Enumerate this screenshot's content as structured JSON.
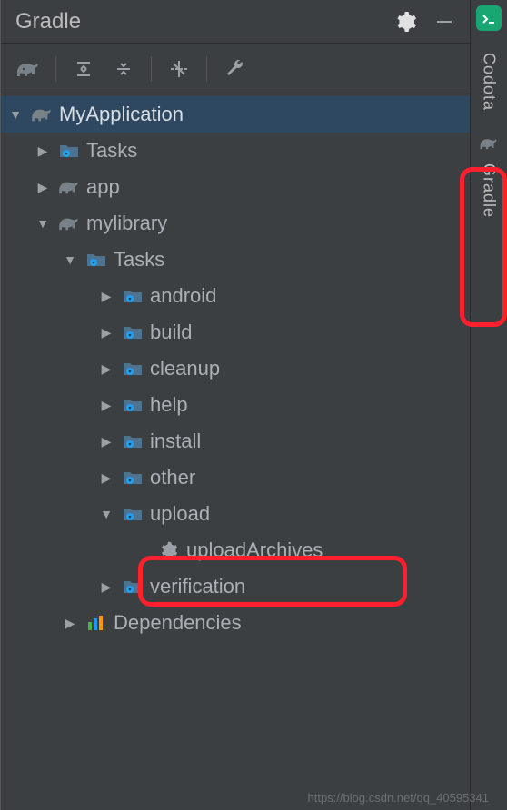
{
  "panel": {
    "title": "Gradle"
  },
  "sidebar": {
    "codota": "Codota",
    "gradle": "Gradle"
  },
  "tree": {
    "root": "MyApplication",
    "tasks": "Tasks",
    "app": "app",
    "mylibrary": "mylibrary",
    "mylib_tasks": "Tasks",
    "groups": {
      "android": "android",
      "build": "build",
      "cleanup": "cleanup",
      "help": "help",
      "install": "install",
      "other": "other",
      "upload": "upload",
      "verification": "verification"
    },
    "uploadArchives": "uploadArchives",
    "dependencies": "Dependencies"
  },
  "watermark": "https://blog.csdn.net/qq_40595341"
}
